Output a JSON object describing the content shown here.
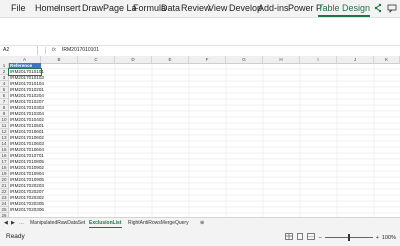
{
  "ribbon": {
    "tabs": [
      "File",
      "Home",
      "Insert",
      "Draw",
      "Page La",
      "Formula",
      "Data",
      "Review",
      "View",
      "Develop",
      "Add-ins",
      "Power P",
      "Table Design"
    ],
    "active_tab": "Table Design"
  },
  "formula_bar": {
    "name_box": "A2",
    "fx": "fx",
    "formula": "IRM2017010101"
  },
  "columns": [
    "A",
    "B",
    "C",
    "D",
    "E",
    "F",
    "G",
    "H",
    "I",
    "J",
    "K",
    "L",
    "M",
    "N"
  ],
  "rows": [
    "1",
    "2",
    "3",
    "4",
    "5",
    "6",
    "7",
    "8",
    "9",
    "10",
    "11",
    "12",
    "13",
    "14",
    "15",
    "16",
    "17",
    "18",
    "19",
    "20",
    "21",
    "22",
    "23",
    "24",
    "25",
    "26"
  ],
  "table": {
    "header": "Reference",
    "values": [
      "IRM2017010101",
      "IRM2017010103",
      "IRM2017010104",
      "IRM2017010201",
      "IRM2017010204",
      "IRM2017010207",
      "IRM2017010303",
      "IRM2017010304",
      "IRM2017010402",
      "IRM2017010501",
      "IRM2017010601",
      "IRM2017010602",
      "IRM2017010603",
      "IRM2017010604",
      "IRM2017010701",
      "IRM2017010805",
      "IRM2017010902",
      "IRM2017010904",
      "IRM2017010905",
      "IRM2017020203",
      "IRM2017020207",
      "IRM2017020302",
      "IRM2017020305",
      "IRM2017020306"
    ]
  },
  "sheet_tabs": {
    "items": [
      "ManipulatedRawDataSet",
      "ExclusionList",
      "RightAntiRowsMergeQuery"
    ],
    "active": "ExclusionList"
  },
  "status": {
    "ready": "Ready",
    "zoom": "100%"
  }
}
